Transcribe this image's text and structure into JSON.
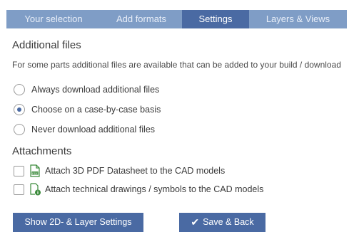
{
  "tabs": {
    "your_selection": "Your selection",
    "add_formats": "Add formats",
    "settings": "Settings",
    "layers_views": "Layers & Views"
  },
  "additional_files": {
    "heading": "Additional files",
    "description": "For some parts additional files are available that can be added to your build / download",
    "options": [
      "Always download additional files",
      "Choose on a case-by-case basis",
      "Never download additional files"
    ],
    "selected_index": 1
  },
  "attachments": {
    "heading": "Attachments",
    "items": [
      {
        "label": "Attach 3D PDF Datasheet to the CAD models",
        "icon": "pdf-file-icon",
        "checked": false
      },
      {
        "label": "Attach technical drawings / symbols to the CAD models",
        "icon": "drawing-info-file-icon",
        "checked": false
      }
    ]
  },
  "buttons": {
    "layer_settings": "Show 2D- & Layer Settings",
    "save_back": "Save & Back"
  },
  "colors": {
    "tab_bar": "#7f9dc6",
    "tab_active": "#4a6aa3",
    "button": "#4a6aa3",
    "icon_green": "#3a8a3a"
  }
}
